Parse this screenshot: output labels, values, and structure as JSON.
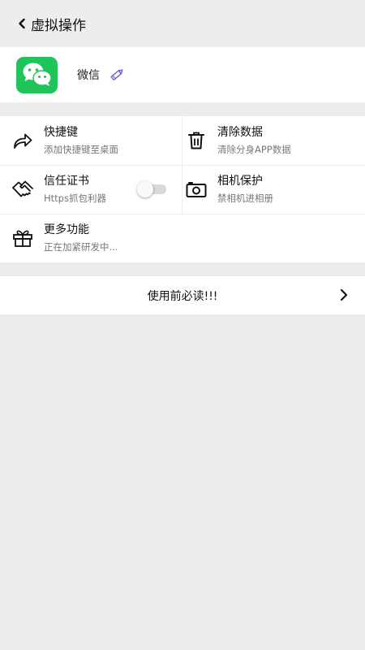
{
  "header": {
    "title": "虚拟操作"
  },
  "app": {
    "name": "微信",
    "icon": "wechat-icon",
    "icon_color": "#1fc45a"
  },
  "features": [
    {
      "title": "快捷键",
      "subtitle": "添加快捷键至桌面",
      "icon": "share-arrow-icon"
    },
    {
      "title": "清除数据",
      "subtitle": "清除分身APP数据",
      "icon": "trash-icon"
    },
    {
      "title": "信任证书",
      "subtitle": "Https抓包利器",
      "icon": "handshake-icon",
      "toggle_on": false
    },
    {
      "title": "相机保护",
      "subtitle": "禁相机进相册",
      "icon": "camera-icon"
    },
    {
      "title": "更多功能",
      "subtitle": "正在加紧研发中...",
      "icon": "gift-icon"
    }
  ],
  "notice": {
    "label": "使用前必读!!!"
  },
  "colors": {
    "background": "#ececec",
    "card": "#ffffff",
    "accent_pencil": "#7a5bd6"
  }
}
